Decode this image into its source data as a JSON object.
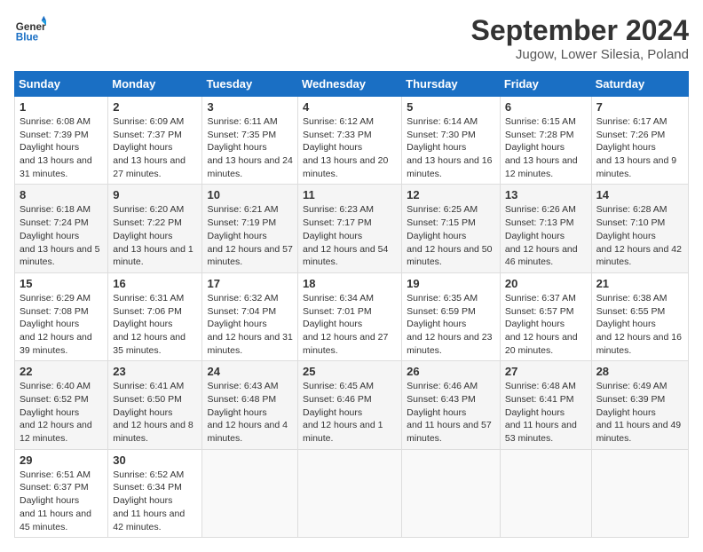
{
  "header": {
    "logo_line1": "General",
    "logo_line2": "Blue",
    "title": "September 2024",
    "subtitle": "Jugow, Lower Silesia, Poland"
  },
  "weekdays": [
    "Sunday",
    "Monday",
    "Tuesday",
    "Wednesday",
    "Thursday",
    "Friday",
    "Saturday"
  ],
  "weeks": [
    [
      {
        "day": "1",
        "sunrise": "6:08 AM",
        "sunset": "7:39 PM",
        "daylight": "13 hours and 31 minutes."
      },
      {
        "day": "2",
        "sunrise": "6:09 AM",
        "sunset": "7:37 PM",
        "daylight": "13 hours and 27 minutes."
      },
      {
        "day": "3",
        "sunrise": "6:11 AM",
        "sunset": "7:35 PM",
        "daylight": "13 hours and 24 minutes."
      },
      {
        "day": "4",
        "sunrise": "6:12 AM",
        "sunset": "7:33 PM",
        "daylight": "13 hours and 20 minutes."
      },
      {
        "day": "5",
        "sunrise": "6:14 AM",
        "sunset": "7:30 PM",
        "daylight": "13 hours and 16 minutes."
      },
      {
        "day": "6",
        "sunrise": "6:15 AM",
        "sunset": "7:28 PM",
        "daylight": "13 hours and 12 minutes."
      },
      {
        "day": "7",
        "sunrise": "6:17 AM",
        "sunset": "7:26 PM",
        "daylight": "13 hours and 9 minutes."
      }
    ],
    [
      {
        "day": "8",
        "sunrise": "6:18 AM",
        "sunset": "7:24 PM",
        "daylight": "13 hours and 5 minutes."
      },
      {
        "day": "9",
        "sunrise": "6:20 AM",
        "sunset": "7:22 PM",
        "daylight": "13 hours and 1 minute."
      },
      {
        "day": "10",
        "sunrise": "6:21 AM",
        "sunset": "7:19 PM",
        "daylight": "12 hours and 57 minutes."
      },
      {
        "day": "11",
        "sunrise": "6:23 AM",
        "sunset": "7:17 PM",
        "daylight": "12 hours and 54 minutes."
      },
      {
        "day": "12",
        "sunrise": "6:25 AM",
        "sunset": "7:15 PM",
        "daylight": "12 hours and 50 minutes."
      },
      {
        "day": "13",
        "sunrise": "6:26 AM",
        "sunset": "7:13 PM",
        "daylight": "12 hours and 46 minutes."
      },
      {
        "day": "14",
        "sunrise": "6:28 AM",
        "sunset": "7:10 PM",
        "daylight": "12 hours and 42 minutes."
      }
    ],
    [
      {
        "day": "15",
        "sunrise": "6:29 AM",
        "sunset": "7:08 PM",
        "daylight": "12 hours and 39 minutes."
      },
      {
        "day": "16",
        "sunrise": "6:31 AM",
        "sunset": "7:06 PM",
        "daylight": "12 hours and 35 minutes."
      },
      {
        "day": "17",
        "sunrise": "6:32 AM",
        "sunset": "7:04 PM",
        "daylight": "12 hours and 31 minutes."
      },
      {
        "day": "18",
        "sunrise": "6:34 AM",
        "sunset": "7:01 PM",
        "daylight": "12 hours and 27 minutes."
      },
      {
        "day": "19",
        "sunrise": "6:35 AM",
        "sunset": "6:59 PM",
        "daylight": "12 hours and 23 minutes."
      },
      {
        "day": "20",
        "sunrise": "6:37 AM",
        "sunset": "6:57 PM",
        "daylight": "12 hours and 20 minutes."
      },
      {
        "day": "21",
        "sunrise": "6:38 AM",
        "sunset": "6:55 PM",
        "daylight": "12 hours and 16 minutes."
      }
    ],
    [
      {
        "day": "22",
        "sunrise": "6:40 AM",
        "sunset": "6:52 PM",
        "daylight": "12 hours and 12 minutes."
      },
      {
        "day": "23",
        "sunrise": "6:41 AM",
        "sunset": "6:50 PM",
        "daylight": "12 hours and 8 minutes."
      },
      {
        "day": "24",
        "sunrise": "6:43 AM",
        "sunset": "6:48 PM",
        "daylight": "12 hours and 4 minutes."
      },
      {
        "day": "25",
        "sunrise": "6:45 AM",
        "sunset": "6:46 PM",
        "daylight": "12 hours and 1 minute."
      },
      {
        "day": "26",
        "sunrise": "6:46 AM",
        "sunset": "6:43 PM",
        "daylight": "11 hours and 57 minutes."
      },
      {
        "day": "27",
        "sunrise": "6:48 AM",
        "sunset": "6:41 PM",
        "daylight": "11 hours and 53 minutes."
      },
      {
        "day": "28",
        "sunrise": "6:49 AM",
        "sunset": "6:39 PM",
        "daylight": "11 hours and 49 minutes."
      }
    ],
    [
      {
        "day": "29",
        "sunrise": "6:51 AM",
        "sunset": "6:37 PM",
        "daylight": "11 hours and 45 minutes."
      },
      {
        "day": "30",
        "sunrise": "6:52 AM",
        "sunset": "6:34 PM",
        "daylight": "11 hours and 42 minutes."
      },
      null,
      null,
      null,
      null,
      null
    ]
  ]
}
